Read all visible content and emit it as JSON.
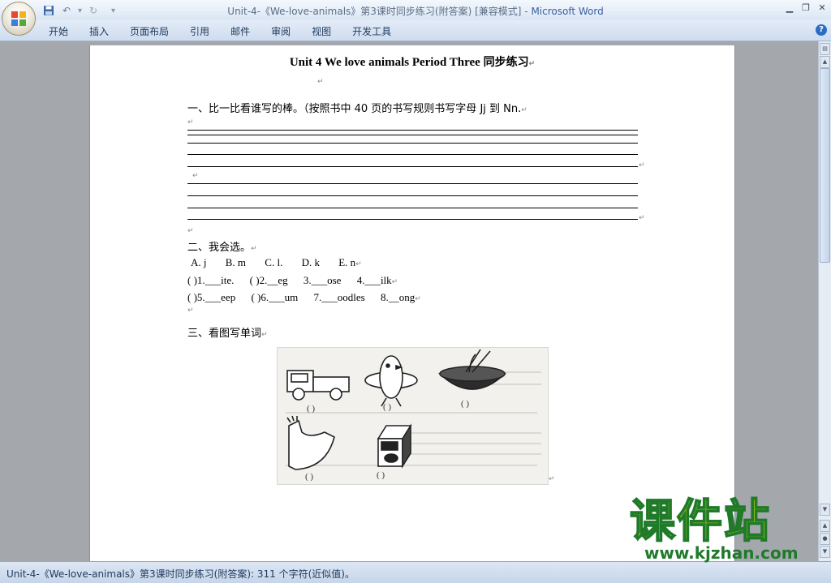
{
  "window": {
    "title_doc": "Unit-4-《We-love-animals》第3课时同步练习(附答案) [兼容模式] - ",
    "title_app": "Microsoft Word"
  },
  "quick_access": {
    "save_icon": "save-icon",
    "undo_icon": "undo-icon",
    "redo_icon": "redo-icon",
    "customize_icon": "customize-icon"
  },
  "ribbon": {
    "tabs": [
      "开始",
      "插入",
      "页面布局",
      "引用",
      "邮件",
      "审阅",
      "视图",
      "开发工具"
    ]
  },
  "document": {
    "title_en": "Unit 4 We love animals Period Three ",
    "title_cn": "同步练习",
    "section1": "一、比一比看谁写的棒。（按照书中 40 页的书写规则书写字母 Jj 到 Nn.",
    "section2": "二、我会选。",
    "options": [
      "A.     j",
      "B.    m",
      "C.     l.",
      "D.     k",
      "E.     n"
    ],
    "questions_row1": [
      "(        )1.___ite.",
      "(        )2.__eg",
      "3.___ose",
      "4.___ilk"
    ],
    "questions_row2": [
      "(        )5.___eep",
      "(        )6.___um",
      "7.___oodles",
      "8.__ong"
    ],
    "section3": "三、看图写单词",
    "picture_items": [
      "truck",
      "chick",
      "noodles",
      "arm",
      "milk"
    ]
  },
  "statusbar": {
    "text": "Unit-4-《We-love-animals》第3课时同步练习(附答案): 311 个字符(近似值)。"
  },
  "watermark": {
    "cn": "课件站",
    "url": "www.kjzhan.com"
  },
  "colors": {
    "title_app": "#3a5f9e",
    "watermark_fill": "#f3e600",
    "watermark_stroke": "#1f7a2a"
  }
}
